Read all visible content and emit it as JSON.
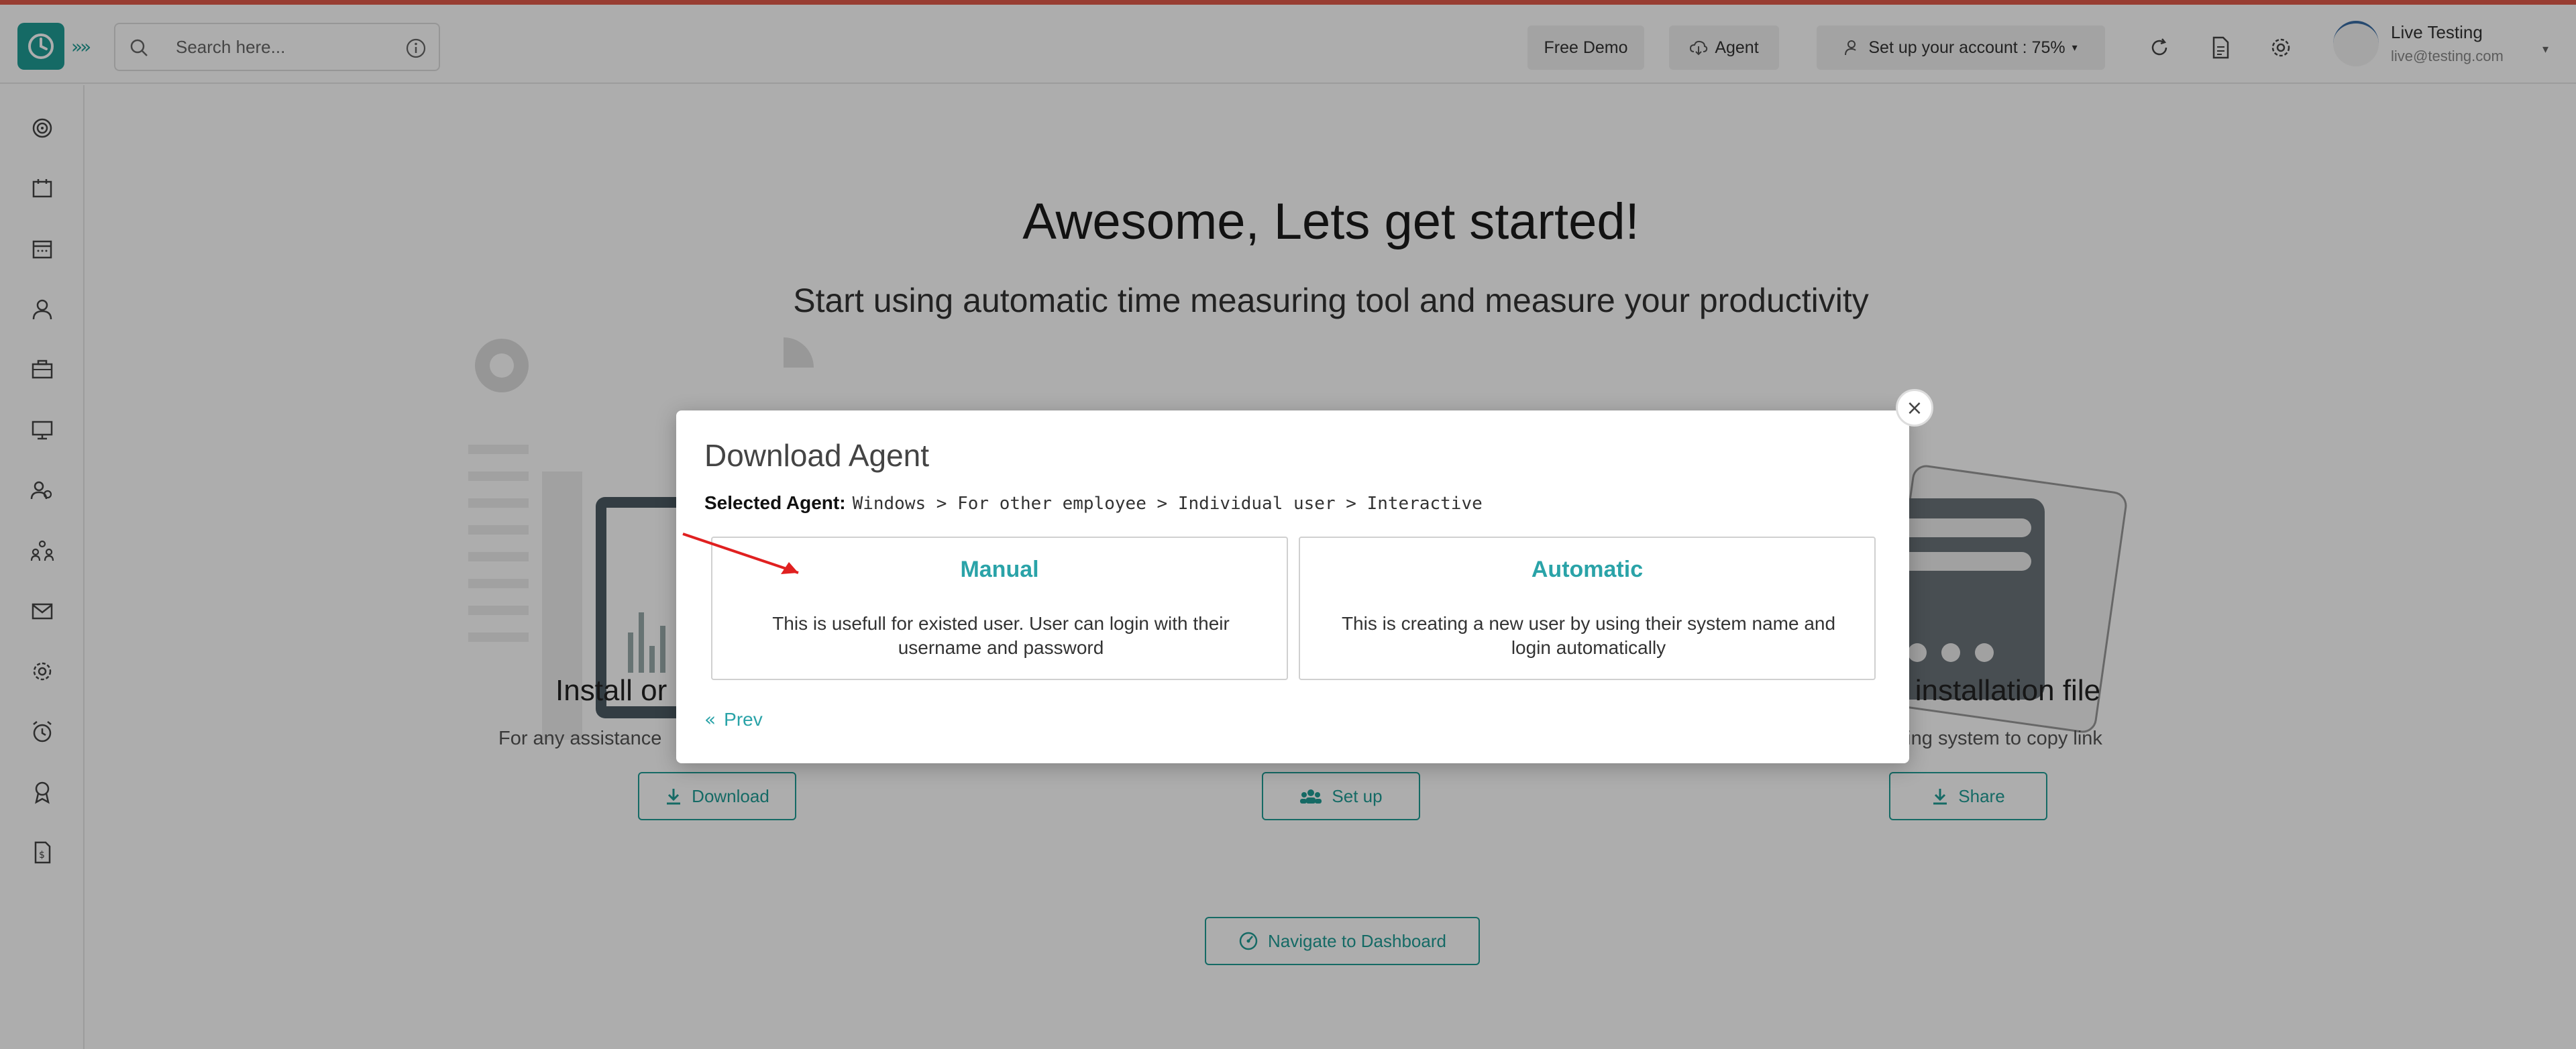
{
  "topbar": {
    "search_placeholder": "Search here...",
    "free_demo": "Free Demo",
    "agent": "Agent",
    "setup_account": "Set up your account : 75%",
    "user_name": "Live Testing",
    "user_email": "live@testing.com"
  },
  "main": {
    "heading": "Awesome, Lets get started!",
    "subheading": "Start using automatic time measuring tool and measure your productivity",
    "col1_title": "Install or",
    "col1_sub": "For any assistance",
    "col1_button": "Download",
    "col2_button": "Set up",
    "col3_title": "e installation file",
    "col3_sub": "ating system to copy link",
    "col3_button": "Share",
    "navigate_button": "Navigate to Dashboard"
  },
  "modal": {
    "title": "Download Agent",
    "selected_label": "Selected Agent:",
    "selected_path": "Windows > For other employee > Individual user > Interactive",
    "options": [
      {
        "title": "Manual",
        "desc": "This is usefull for existed user. User can login with their username and password"
      },
      {
        "title": "Automatic",
        "desc": "This is creating a new user by using their system name and login automatically"
      }
    ],
    "prev": "Prev",
    "close": "×"
  },
  "colors": {
    "accent": "#1f9c95",
    "option_title": "#2aa3a8",
    "annotation_arrow": "#e02020"
  }
}
